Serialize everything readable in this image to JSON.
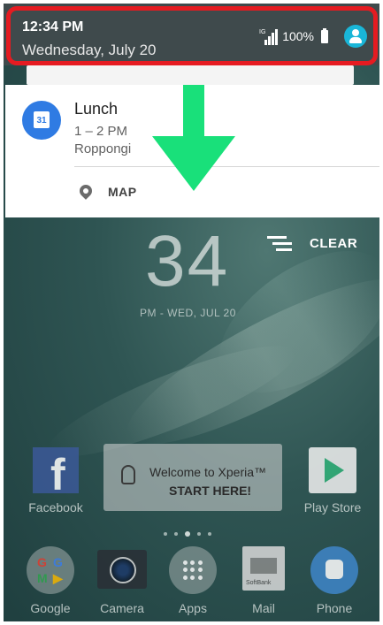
{
  "status_bar": {
    "time": "12:34 PM",
    "date": "Wednesday, July 20",
    "network_badge": "IG",
    "battery": "100%",
    "icons": [
      "signal-icon",
      "battery-icon",
      "account-icon"
    ]
  },
  "notification": {
    "app_icon": "calendar-icon",
    "calendar_day": "31",
    "title": "Lunch",
    "time": "1 – 2 PM",
    "location": "Roppongi",
    "action_label": "MAP",
    "action_icon": "location-pin-icon"
  },
  "clock": {
    "time": "34",
    "subtitle": "PM - WED, JUL 20"
  },
  "clear": {
    "label": "CLEAR"
  },
  "home": {
    "apps": [
      {
        "label": "Facebook"
      },
      {
        "label": "Play Store"
      }
    ],
    "welcome": {
      "line1": "Welcome to Xperia™",
      "line2": "START HERE!"
    },
    "dock": [
      {
        "label": "Google"
      },
      {
        "label": "Camera"
      },
      {
        "label": "Apps"
      },
      {
        "label": "Mail"
      },
      {
        "label": "Phone"
      }
    ],
    "mail_tag": "SoftBank"
  },
  "colors": {
    "highlight_border": "#e51b21",
    "arrow": "#19e07a",
    "status_bar_bg": "#3f4a4c",
    "account_icon": "#19b6d8",
    "calendar_icon": "#2f7be3"
  }
}
